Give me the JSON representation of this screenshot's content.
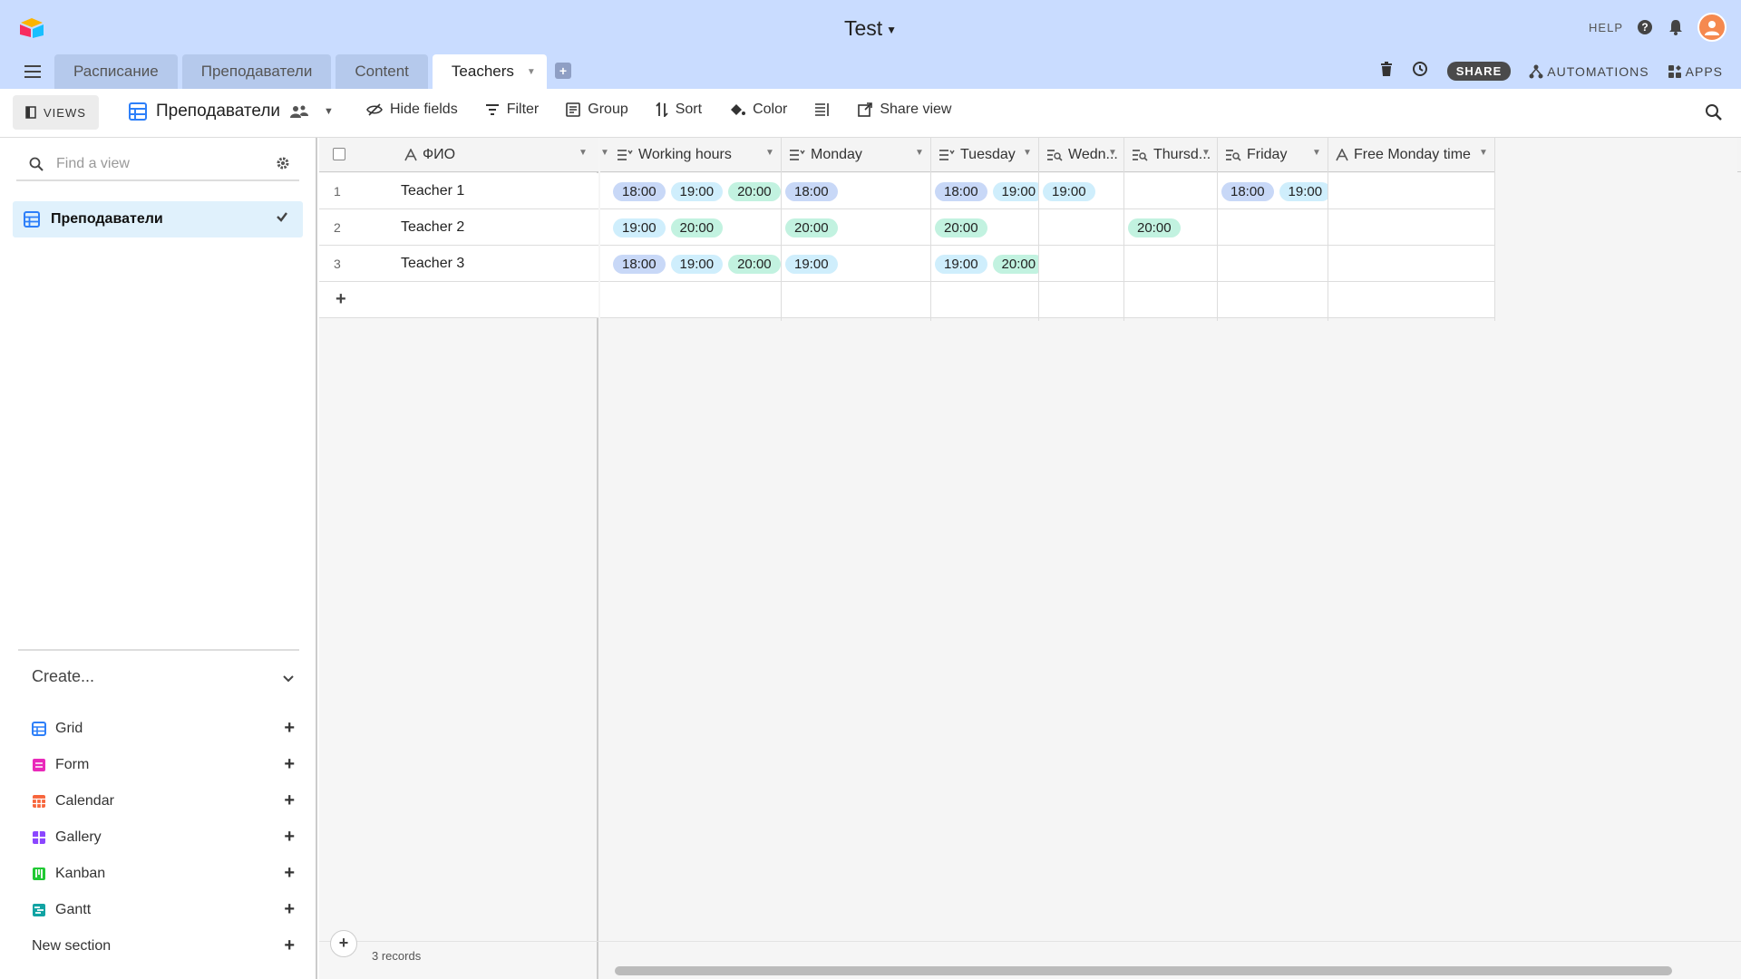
{
  "app": {
    "title": "Test",
    "tabs": [
      {
        "label": "Расписание"
      },
      {
        "label": "Преподаватели"
      },
      {
        "label": "Content"
      },
      {
        "label": "Teachers"
      }
    ],
    "help_label": "HELP",
    "share_label": "SHARE",
    "automations_label": "AUTOMATIONS",
    "apps_label": "APPS",
    "accent_color": "#c9dcff"
  },
  "toolbar": {
    "views_label": "VIEWS",
    "view_name": "Преподаватели",
    "hide_fields": "Hide fields",
    "filter": "Filter",
    "group": "Group",
    "sort": "Sort",
    "color": "Color",
    "share_view": "Share view"
  },
  "sidebar": {
    "find_placeholder": "Find a view",
    "views": [
      {
        "label": "Преподаватели"
      }
    ],
    "create_label": "Create...",
    "create_items": [
      {
        "label": "Grid",
        "color": "#2d7ff9"
      },
      {
        "label": "Form",
        "color": "#e929ba"
      },
      {
        "label": "Calendar",
        "color": "#f7653b"
      },
      {
        "label": "Gallery",
        "color": "#8b46ff"
      },
      {
        "label": "Kanban",
        "color": "#20c933"
      },
      {
        "label": "Gantt",
        "color": "#11a3a3"
      },
      {
        "label": "New section"
      }
    ]
  },
  "grid": {
    "primary_header": "ФИО",
    "headers": [
      "Working hours",
      "Monday",
      "Tuesday",
      "Wedn...",
      "Thursd...",
      "Friday",
      "Free Monday time"
    ],
    "rows": [
      {
        "num": "1",
        "name": "Teacher 1",
        "working": [
          "18:00",
          "19:00",
          "20:00"
        ],
        "monday": [
          "18:00"
        ],
        "tuesday": [
          "18:00",
          "19:00"
        ],
        "wednesday": [
          "19:00"
        ],
        "thursday": [],
        "friday": [
          "18:00",
          "19:00"
        ],
        "free_monday": ""
      },
      {
        "num": "2",
        "name": "Teacher 2",
        "working": [
          "19:00",
          "20:00"
        ],
        "monday": [
          "20:00"
        ],
        "tuesday": [
          "20:00"
        ],
        "wednesday": [],
        "thursday": [
          "20:00"
        ],
        "friday": [],
        "free_monday": ""
      },
      {
        "num": "3",
        "name": "Teacher 3",
        "working": [
          "18:00",
          "19:00",
          "20:00"
        ],
        "monday": [
          "19:00"
        ],
        "tuesday": [
          "19:00",
          "20:00"
        ],
        "wednesday": [],
        "thursday": [],
        "friday": [],
        "free_monday": ""
      }
    ],
    "pill_colors": {
      "18:00": "blue",
      "19:00": "cyan",
      "20:00": "teal"
    },
    "record_count": "3 records"
  }
}
